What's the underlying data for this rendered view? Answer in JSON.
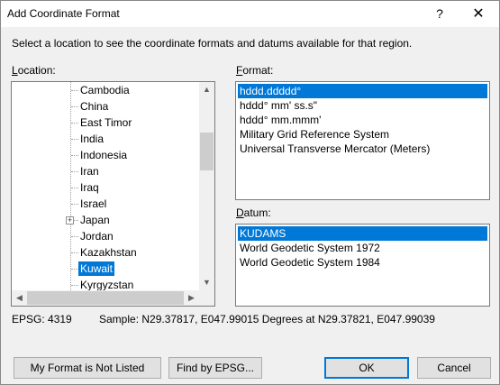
{
  "window": {
    "title": "Add Coordinate Format",
    "help_label": "?",
    "close_label": "✕"
  },
  "instruction": "Select a location to see the coordinate formats and datums available for that region.",
  "location": {
    "label": "Location:",
    "items": [
      {
        "label": "Cambodia",
        "selected": false,
        "expandable": false
      },
      {
        "label": "China",
        "selected": false,
        "expandable": false
      },
      {
        "label": "East Timor",
        "selected": false,
        "expandable": false
      },
      {
        "label": "India",
        "selected": false,
        "expandable": false
      },
      {
        "label": "Indonesia",
        "selected": false,
        "expandable": false
      },
      {
        "label": "Iran",
        "selected": false,
        "expandable": false
      },
      {
        "label": "Iraq",
        "selected": false,
        "expandable": false
      },
      {
        "label": "Israel",
        "selected": false,
        "expandable": false
      },
      {
        "label": "Japan",
        "selected": false,
        "expandable": true
      },
      {
        "label": "Jordan",
        "selected": false,
        "expandable": false
      },
      {
        "label": "Kazakhstan",
        "selected": false,
        "expandable": false
      },
      {
        "label": "Kuwait",
        "selected": true,
        "expandable": false
      },
      {
        "label": "Kyrgyzstan",
        "selected": false,
        "expandable": false
      }
    ],
    "expander_glyph": "+"
  },
  "format": {
    "label": "Format:",
    "items": [
      {
        "label": "hddd.ddddd°",
        "selected": true
      },
      {
        "label": "hddd° mm' ss.s\"",
        "selected": false
      },
      {
        "label": "hddd° mm.mmm'",
        "selected": false
      },
      {
        "label": "Military Grid Reference System",
        "selected": false
      },
      {
        "label": "Universal Transverse Mercator (Meters)",
        "selected": false
      }
    ]
  },
  "datum": {
    "label": "Datum:",
    "items": [
      {
        "label": "KUDAMS",
        "selected": true
      },
      {
        "label": "World Geodetic System 1972",
        "selected": false
      },
      {
        "label": "World Geodetic System 1984",
        "selected": false
      }
    ]
  },
  "status": {
    "epsg": "EPSG: 4319",
    "sample": "Sample: N29.37817, E047.99015 Degrees at N29.37821, E047.99039"
  },
  "buttons": {
    "not_listed": "My Format is Not Listed",
    "find_epsg": "Find by EPSG...",
    "ok": "OK",
    "cancel": "Cancel"
  },
  "scroll_arrows": {
    "up": "▲",
    "down": "▼",
    "left": "◀",
    "right": "▶"
  },
  "colors": {
    "selection": "#0078d7",
    "default_button_border": "#0078d7"
  }
}
